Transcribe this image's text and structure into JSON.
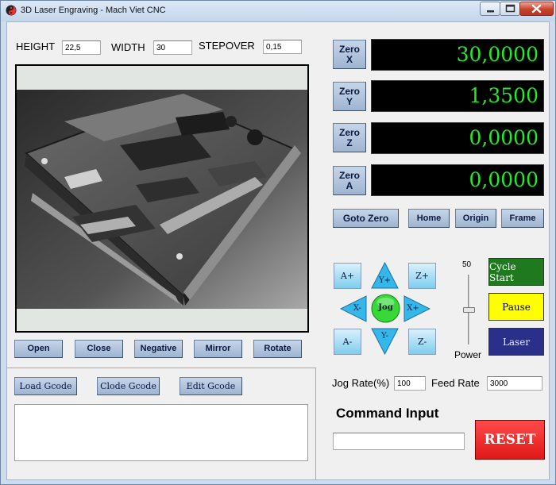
{
  "window": {
    "title": "3D Laser Engraving - Mach Viet CNC",
    "icons": {
      "app": "app-logo-icon",
      "minimize": "minimize-icon",
      "maximize": "maximize-icon",
      "close": "close-icon"
    }
  },
  "params": {
    "height_label": "HEIGHT",
    "height_value": "22,5",
    "width_label": "WIDTH",
    "width_value": "30",
    "stepover_label": "STEPOVER",
    "stepover_value": "0,15"
  },
  "image_buttons": [
    "Open",
    "Close",
    "Negative",
    "Mirror",
    "Rotate"
  ],
  "gcode": {
    "load_label": "Load Gcode",
    "close_label": "Clode Gcode",
    "edit_label": "Edit Gcode",
    "text": ""
  },
  "axes": [
    {
      "zero_label_1": "Zero",
      "zero_label_2": "X",
      "value": "30,0000"
    },
    {
      "zero_label_1": "Zero",
      "zero_label_2": "Y",
      "value": "1,3500"
    },
    {
      "zero_label_1": "Zero",
      "zero_label_2": "Z",
      "value": "0,0000"
    },
    {
      "zero_label_1": "Zero",
      "zero_label_2": "A",
      "value": "0,0000"
    }
  ],
  "position_buttons": {
    "goto_zero": "Goto Zero",
    "home": "Home",
    "origin": "Origin",
    "frame": "Frame"
  },
  "jog": {
    "a_plus": "A+",
    "a_minus": "A-",
    "z_plus": "Z+",
    "z_minus": "Z-",
    "y_plus": "Y+",
    "y_minus": "Y-",
    "x_plus": "X+",
    "x_minus": "X-",
    "center": "Jog"
  },
  "power": {
    "value": "50",
    "label": "Power",
    "level_fraction": 0.5
  },
  "controls": {
    "cycle_start": "Cycle Start",
    "pause": "Pause",
    "laser": "Laser",
    "colors": {
      "cycle_start": "#1f7a1f",
      "pause": "#ffff00",
      "laser": "#2a2f8a"
    }
  },
  "rates": {
    "jog_label": "Jog Rate(%)",
    "jog_value": "100",
    "feed_label": "Feed Rate",
    "feed_value": "3000"
  },
  "command": {
    "label": "Command Input",
    "value": ""
  },
  "reset_label": "RESET",
  "colors": {
    "dro_text": "#24ec24",
    "dro_bg": "#000000",
    "reset": "#ee1c1c",
    "button": "#a9bdd8"
  }
}
